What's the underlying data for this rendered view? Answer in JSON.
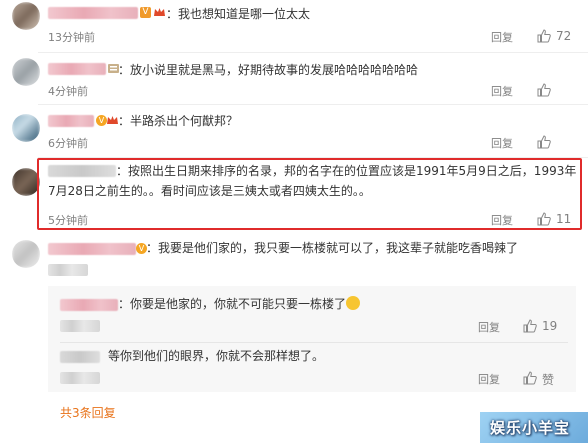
{
  "comments": [
    {
      "text": "：我也想知道是哪一位太太",
      "time": "13分钟前",
      "reply": "回复",
      "likes": "72"
    },
    {
      "text": "：放小说里就是黑马，好期待故事的发展哈哈哈哈哈哈哈",
      "time": "4分钟前",
      "reply": "回复",
      "likes_icon": "like-icon"
    },
    {
      "text": "：半路杀出个何猷邦？",
      "time": "6分钟前",
      "reply": "回复",
      "likes_icon": "like-icon"
    },
    {
      "text_line1": "：按照出生日期来排序的名录，邦的名字在的位置应该是1991年5月9日之后，1993年",
      "text_line2": "7月28日之前生的。。看时间应该是三姨太或者四姨太生的。。",
      "time": "5分钟前",
      "reply": "回复",
      "likes": "11"
    },
    {
      "text": "：我要是他们家的，我只要一栋楼就可以了，我这辈子就能吃香喝辣了",
      "replies": [
        {
          "text": "：你要是他家的，你就不可能只要一栋楼了",
          "reply": "回复",
          "likes": "19"
        },
        {
          "text": "等你到他们的眼界，你就不会那样想了。",
          "reply": "回复",
          "likes": "赞"
        }
      ],
      "view_replies": "共3条回复"
    }
  ],
  "watermark": "娱乐小羊宝",
  "colors": {
    "highlight_border": "#e02b2b",
    "link_orange": "#e8731a",
    "muted": "#808080"
  }
}
